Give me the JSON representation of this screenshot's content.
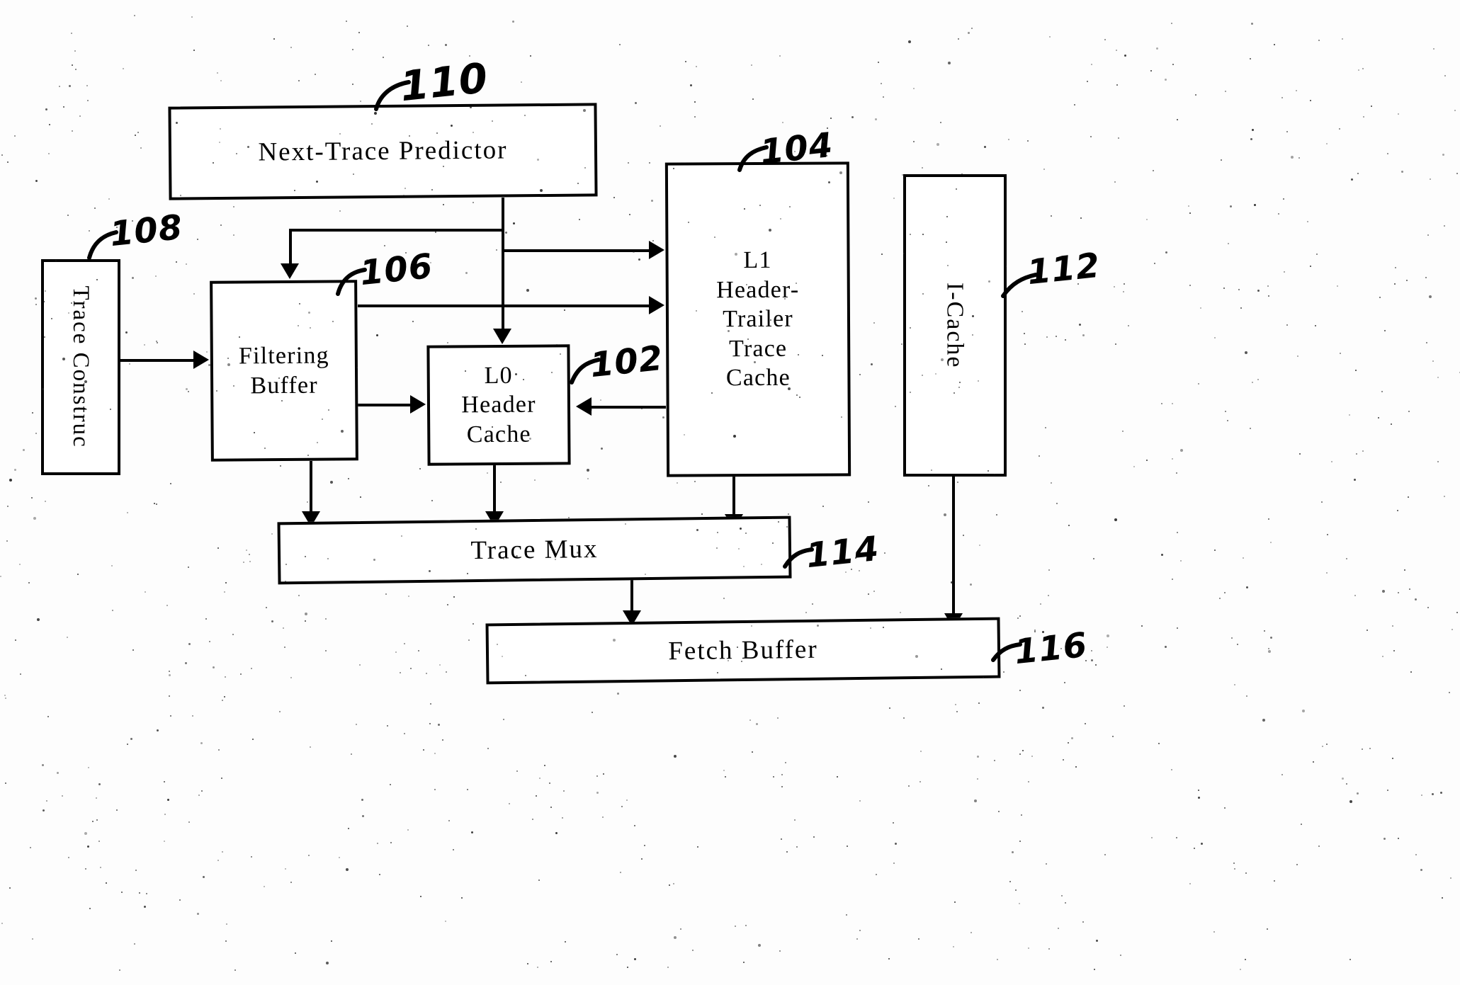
{
  "figure": {
    "type": "patent-block-diagram",
    "background_color": "#fdfdfd",
    "line_color": "#000000"
  },
  "blocks": {
    "next_trace_predictor": {
      "label": "Next-Trace Predictor",
      "ref": "110"
    },
    "trace_construct": {
      "label": "Trace Construc",
      "ref": "108"
    },
    "filtering_buffer": {
      "label": "Filtering\nBuffer",
      "ref": "106"
    },
    "l0_header_cache": {
      "label": "L0\nHeader\nCache",
      "ref": "102"
    },
    "l1_trace_cache": {
      "label": "L1\nHeader-\nTrailer\nTrace\nCache",
      "ref": "104"
    },
    "i_cache": {
      "label": "I-Cache",
      "ref": "112"
    },
    "trace_mux": {
      "label": "Trace Mux",
      "ref": "114"
    },
    "fetch_buffer": {
      "label": "Fetch Buffer",
      "ref": "116"
    }
  },
  "connections": [
    {
      "from": "next_trace_predictor",
      "to": "filtering_buffer",
      "kind": "arrow-down"
    },
    {
      "from": "next_trace_predictor",
      "to": "l0_header_cache",
      "kind": "arrow-down"
    },
    {
      "from": "next_trace_predictor",
      "to": "l1_trace_cache",
      "kind": "arrow-right"
    },
    {
      "from": "trace_construct",
      "to": "filtering_buffer",
      "kind": "arrow-right"
    },
    {
      "from": "filtering_buffer",
      "to": "l1_trace_cache",
      "kind": "arrow-right"
    },
    {
      "from": "filtering_buffer",
      "to": "l0_header_cache",
      "kind": "arrow-right"
    },
    {
      "from": "filtering_buffer",
      "to": "trace_mux",
      "kind": "arrow-down"
    },
    {
      "from": "l1_trace_cache",
      "to": "l0_header_cache",
      "kind": "arrow-left"
    },
    {
      "from": "l0_header_cache",
      "to": "trace_mux",
      "kind": "arrow-down"
    },
    {
      "from": "l1_trace_cache",
      "to": "trace_mux",
      "kind": "arrow-down"
    },
    {
      "from": "trace_mux",
      "to": "fetch_buffer",
      "kind": "arrow-down"
    },
    {
      "from": "i_cache",
      "to": "fetch_buffer",
      "kind": "arrow-down"
    }
  ]
}
